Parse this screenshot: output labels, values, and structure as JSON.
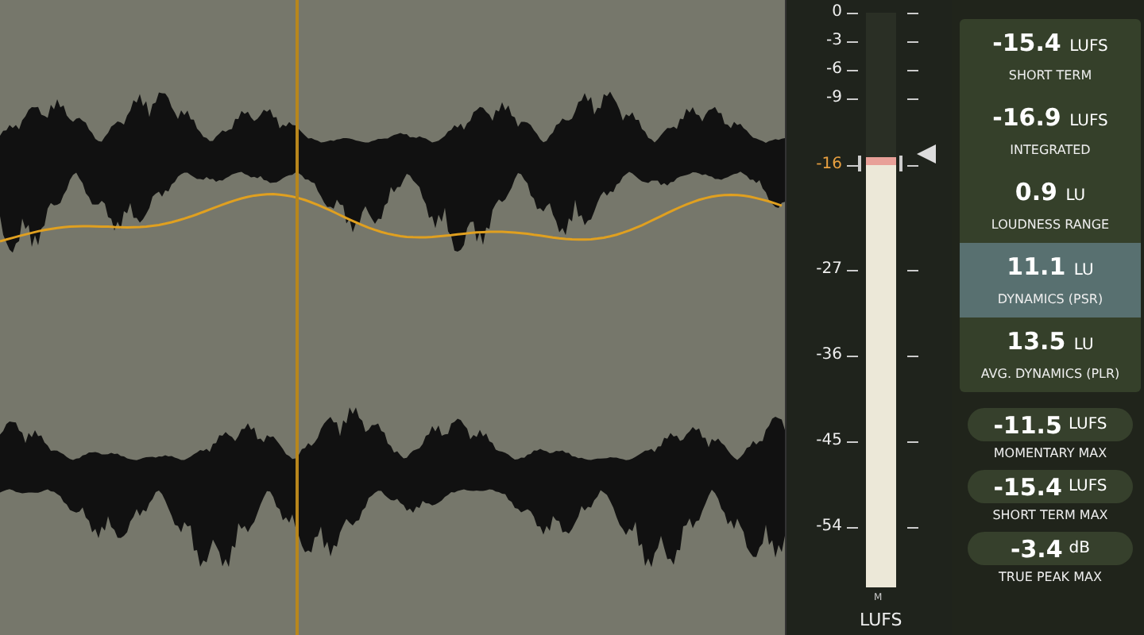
{
  "meter": {
    "scale": [
      {
        "label": "0",
        "target": false
      },
      {
        "label": "-3",
        "target": false
      },
      {
        "label": "-6",
        "target": false
      },
      {
        "label": "-9",
        "target": false
      },
      {
        "label": "-16",
        "target": true
      },
      {
        "label": "-27",
        "target": false
      },
      {
        "label": "-36",
        "target": false
      },
      {
        "label": "-45",
        "target": false
      },
      {
        "label": "-54",
        "target": false
      }
    ],
    "level": 0.75,
    "channel": "M",
    "unit": "LUFS"
  },
  "readouts": [
    {
      "value": "-15.4",
      "unit": "LUFS",
      "label": "SHORT TERM",
      "selected": false
    },
    {
      "value": "-16.9",
      "unit": "LUFS",
      "label": "INTEGRATED",
      "selected": false
    },
    {
      "value": "0.9",
      "unit": "LU",
      "label": "LOUDNESS RANGE",
      "selected": false
    },
    {
      "value": "11.1",
      "unit": "LU",
      "label": "DYNAMICS (PSR)",
      "selected": true
    },
    {
      "value": "13.5",
      "unit": "LU",
      "label": "AVG. DYNAMICS (PLR)",
      "selected": false
    }
  ],
  "max_readouts": [
    {
      "value": "-11.5",
      "unit": "LUFS",
      "label": "MOMENTARY MAX"
    },
    {
      "value": "-15.4",
      "unit": "LUFS",
      "label": "SHORT TERM MAX"
    },
    {
      "value": "-3.4",
      "unit": "dB",
      "label": "TRUE PEAK MAX"
    }
  ]
}
